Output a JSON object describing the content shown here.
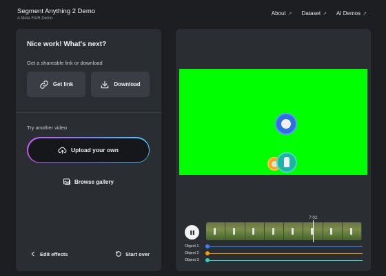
{
  "header": {
    "title": "Segment Anything 2 Demo",
    "subtitle": "A Meta FAIR Demo",
    "nav": [
      {
        "label": "About",
        "icon": "external-arrow-icon"
      },
      {
        "label": "Dataset",
        "icon": "external-arrow-icon"
      },
      {
        "label": "AI Demos",
        "icon": "external-arrow-icon"
      }
    ]
  },
  "left_panel": {
    "heading": "Nice work! What's next?",
    "share_section_label": "Get a shareable link or download",
    "get_link_label": "Get link",
    "download_label": "Download",
    "try_another_label": "Try another video",
    "upload_label": "Upload your own",
    "browse_gallery_label": "Browse gallery",
    "edit_effects_label": "Edit effects",
    "start_over_label": "Start over"
  },
  "player": {
    "time": "7:02",
    "background_color": "#00ff00",
    "objects": [
      {
        "label": "Object 1",
        "color": "#3b82f6"
      },
      {
        "label": "Object 2",
        "color": "#f59e0b"
      },
      {
        "label": "Object 3",
        "color": "#2dd4bf"
      }
    ]
  }
}
